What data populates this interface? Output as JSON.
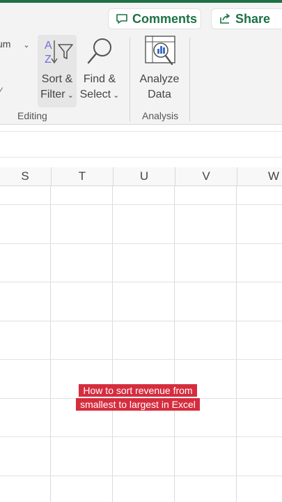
{
  "header": {
    "comments_label": "Comments",
    "share_label": "Share"
  },
  "ribbon": {
    "partial_label": "um",
    "sort_filter": {
      "line1": "Sort &",
      "line2": "Filter"
    },
    "find_select": {
      "line1": "Find &",
      "line2": "Select"
    },
    "analyze_data": {
      "line1": "Analyze",
      "line2": "Data"
    },
    "groups": {
      "editing": "Editing",
      "analysis": "Analysis"
    }
  },
  "columns": [
    "S",
    "T",
    "U",
    "V",
    "W"
  ],
  "caption": "How to sort revenue from smallest to largest in Excel",
  "colors": {
    "accent": "#1e7145",
    "caption_bg": "#d62d3e"
  }
}
